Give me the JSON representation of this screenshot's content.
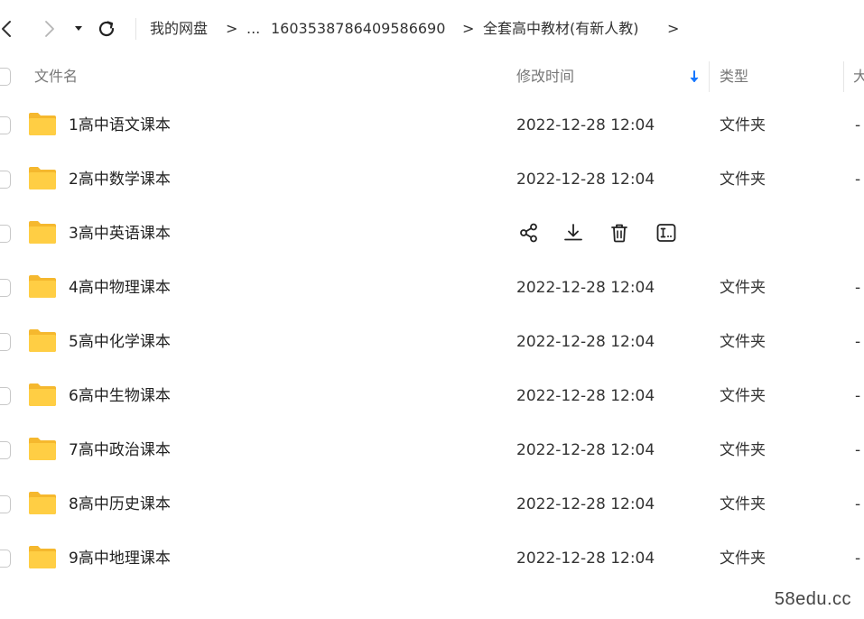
{
  "nav": {
    "back_icon": "chevron-left-icon",
    "forward_icon": "chevron-right-icon",
    "history_icon": "caret-down-icon",
    "refresh_icon": "refresh-icon"
  },
  "breadcrumb": {
    "items": [
      "我的网盘",
      "...",
      "1603538786409586690",
      "全套高中教材(有新人教)"
    ],
    "separator": ">"
  },
  "table": {
    "headers": {
      "name": "文件名",
      "modified": "修改时间",
      "type": "类型",
      "size": "大"
    },
    "sort_icon": "sort-down-arrow-icon",
    "accent_color": "#1677ff",
    "folder_color": "#ffc93d",
    "rows": [
      {
        "name": "1高中语文课本",
        "modified": "2022-12-28 12:04",
        "type": "文件夹",
        "size": "-"
      },
      {
        "name": "2高中数学课本",
        "modified": "2022-12-28 12:04",
        "type": "文件夹",
        "size": "-"
      },
      {
        "name": "3高中英语课本",
        "modified": "",
        "type": "",
        "size": "",
        "hovered": true
      },
      {
        "name": "4高中物理课本",
        "modified": "2022-12-28 12:04",
        "type": "文件夹",
        "size": "-"
      },
      {
        "name": "5高中化学课本",
        "modified": "2022-12-28 12:04",
        "type": "文件夹",
        "size": "-"
      },
      {
        "name": "6高中生物课本",
        "modified": "2022-12-28 12:04",
        "type": "文件夹",
        "size": "-"
      },
      {
        "name": "7高中政治课本",
        "modified": "2022-12-28 12:04",
        "type": "文件夹",
        "size": "-"
      },
      {
        "name": "8高中历史课本",
        "modified": "2022-12-28 12:04",
        "type": "文件夹",
        "size": "-"
      },
      {
        "name": "9高中地理课本",
        "modified": "2022-12-28 12:04",
        "type": "文件夹",
        "size": "-"
      }
    ],
    "hover_actions": [
      "share-icon",
      "download-icon",
      "delete-icon",
      "rename-icon"
    ]
  },
  "watermark": "58edu.cc"
}
